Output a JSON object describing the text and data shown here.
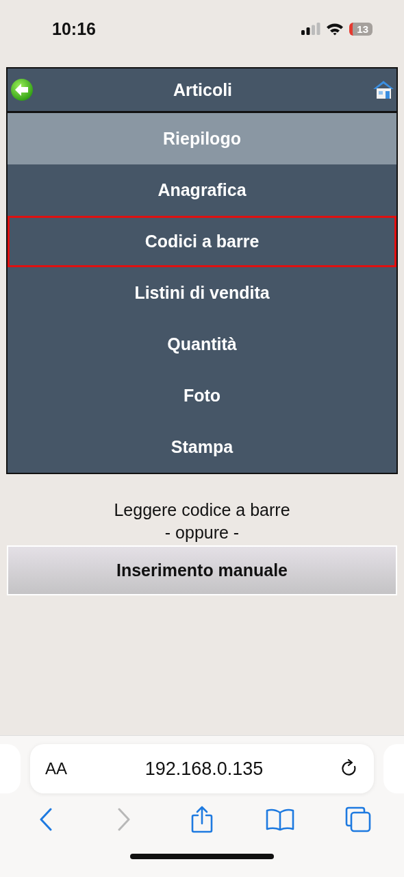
{
  "status_bar": {
    "time": "10:16",
    "battery": "13"
  },
  "header": {
    "title": "Articoli"
  },
  "menu": [
    {
      "label": "Riepilogo",
      "selected": true,
      "highlighted": false
    },
    {
      "label": "Anagrafica",
      "selected": false,
      "highlighted": false
    },
    {
      "label": "Codici a barre",
      "selected": false,
      "highlighted": true
    },
    {
      "label": "Listini di vendita",
      "selected": false,
      "highlighted": false
    },
    {
      "label": "Quantità",
      "selected": false,
      "highlighted": false
    },
    {
      "label": "Foto",
      "selected": false,
      "highlighted": false
    },
    {
      "label": "Stampa",
      "selected": false,
      "highlighted": false
    }
  ],
  "prompt": {
    "line_1": "Leggere codice a barre",
    "line_2": "- oppure -"
  },
  "manual_button": "Inserimento manuale",
  "browser": {
    "text_size_button": "AA",
    "url": "192.168.0.135",
    "toolbar": [
      {
        "kind": "back",
        "disabled": false
      },
      {
        "kind": "forward",
        "disabled": true
      },
      {
        "kind": "share",
        "disabled": false
      },
      {
        "kind": "bookmarks",
        "disabled": false
      },
      {
        "kind": "tabs",
        "disabled": false
      }
    ]
  }
}
